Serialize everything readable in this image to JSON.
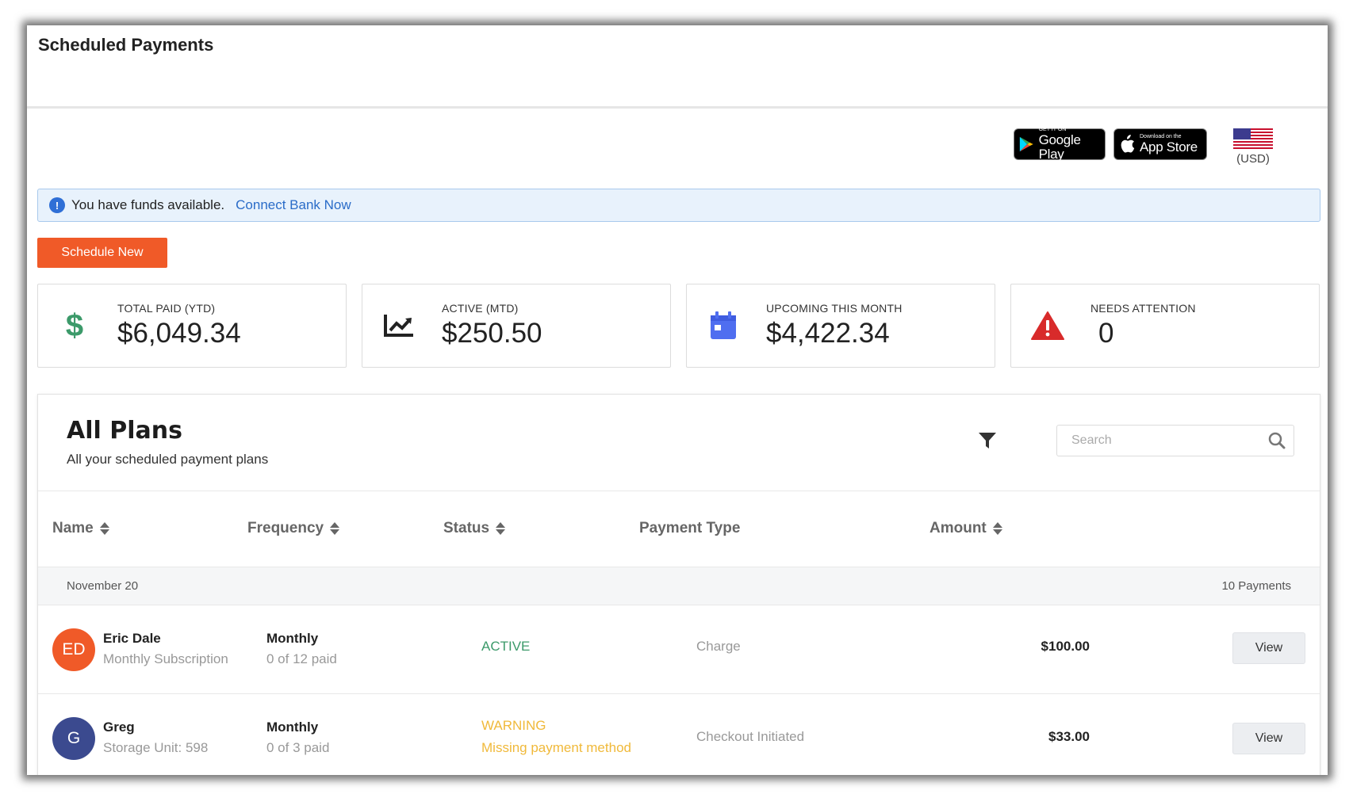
{
  "page": {
    "title": "Scheduled Payments"
  },
  "stores": {
    "google_small": "GET IT ON",
    "google_big": "Google Play",
    "apple_small": "Download on the",
    "apple_big": "App Store"
  },
  "currency": {
    "label": "(USD)"
  },
  "alert": {
    "message": "You have funds available.",
    "link": "Connect Bank Now",
    "icon": "info-icon"
  },
  "actions": {
    "schedule_new": "Schedule New"
  },
  "stats": [
    {
      "label": "TOTAL PAID (YTD)",
      "value": "$6,049.34",
      "icon": "dollar-icon",
      "color": "#3c9a6a"
    },
    {
      "label": "ACTIVE (MTD)",
      "value": "$250.50",
      "icon": "trend-chart-icon",
      "color": "#222222"
    },
    {
      "label": "UPCOMING THIS MONTH",
      "value": "$4,422.34",
      "icon": "calendar-icon",
      "color": "#4f6ef0"
    },
    {
      "label": "NEEDS ATTENTION",
      "value": "0",
      "icon": "warning-icon",
      "color": "#d82b2b"
    }
  ],
  "plans": {
    "title": "All Plans",
    "subtitle": "All your scheduled payment plans",
    "search_placeholder": "Search",
    "columns": [
      "Name",
      "Frequency",
      "Status",
      "Payment Type",
      "Amount"
    ],
    "group": {
      "date": "November 20",
      "count": "10 Payments"
    },
    "rows": [
      {
        "initials": "ED",
        "avatar_color": "#f05a28",
        "name": "Eric Dale",
        "detail": "Monthly Subscription",
        "frequency": "Monthly",
        "progress": "0 of 12 paid",
        "status": "ACTIVE",
        "status_note": "",
        "payment_type": "Charge",
        "amount": "$100.00",
        "action": "View"
      },
      {
        "initials": "G",
        "avatar_color": "#3b4a8f",
        "name": "Greg",
        "detail": "Storage Unit: 598",
        "frequency": "Monthly",
        "progress": "0 of 3 paid",
        "status": "WARNING",
        "status_note": "Missing payment method",
        "payment_type": "Checkout Initiated",
        "amount": "$33.00",
        "action": "View"
      }
    ]
  }
}
